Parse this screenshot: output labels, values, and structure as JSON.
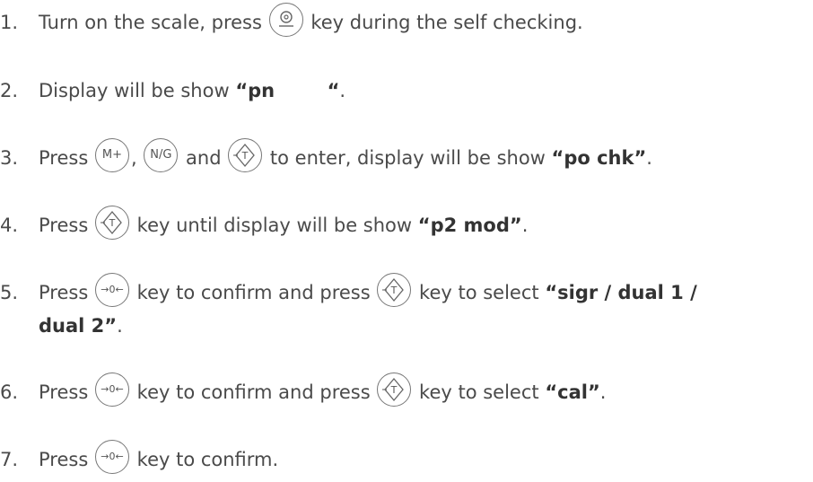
{
  "steps": [
    {
      "num": "1.",
      "before": "Turn on the scale, press",
      "key": "power-zero",
      "after": "key during the self checking."
    },
    {
      "num": "2.",
      "before": "Display will be show",
      "bold": "“pn        “",
      "after": "."
    },
    {
      "num": "3.",
      "before": "Press",
      "key1": "M+",
      "sep1": ",",
      "key2": "N/G",
      "sep2": "and",
      "key3": "tare",
      "after": "to enter, display will be show",
      "bold": "“po chk”",
      "end": "."
    },
    {
      "num": "4.",
      "before": "Press",
      "key": "tare",
      "after": "key until display will be show",
      "bold": "“p2 mod”",
      "end": "."
    },
    {
      "num": "5.",
      "before": "Press",
      "key1": "zero",
      "mid": "key to confirm and press",
      "key2": "tare",
      "after": "key to select",
      "bold_line1": "“sigr / dual 1 /",
      "bold_line2": "dual 2”",
      "end": "."
    },
    {
      "num": "6.",
      "before": "Press",
      "key1": "zero",
      "mid": "key to confirm and press",
      "key2": "tare",
      "after": "key to select",
      "bold": "“cal”",
      "end": "."
    },
    {
      "num": "7.",
      "before": "Press",
      "key": "zero",
      "after": "key to confirm."
    }
  ],
  "key_labels": {
    "mplus": "M+",
    "ng": "N/G",
    "zero": "→0←"
  }
}
